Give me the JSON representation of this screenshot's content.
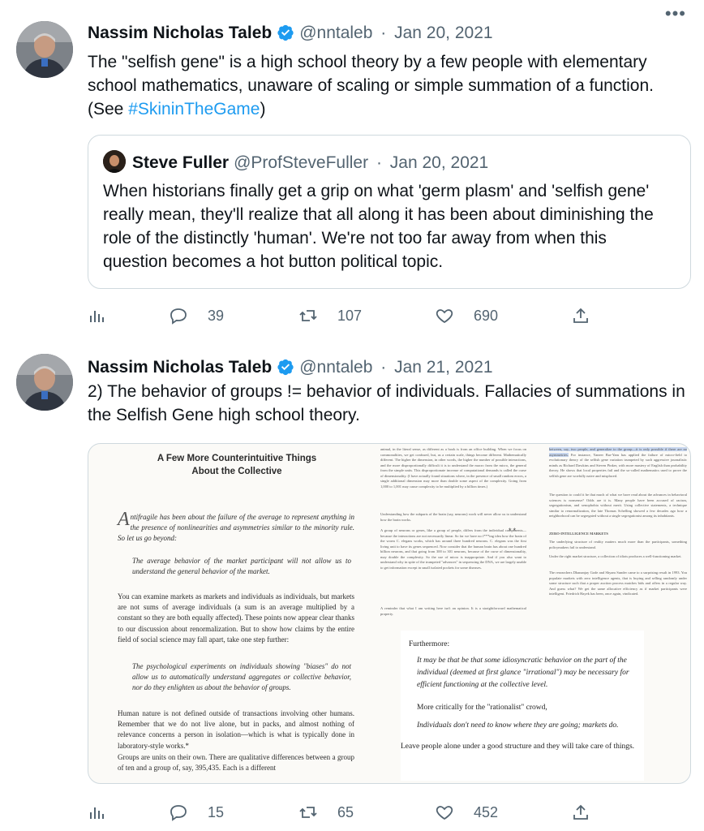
{
  "colors": {
    "link": "#1d9bf0",
    "secondary": "#536471",
    "verified": "#1d9bf0",
    "text": "#0f1419",
    "border": "#cfd9de"
  },
  "tweet1": {
    "author_name": "Nassim Nicholas Taleb",
    "handle": "@nntaleb",
    "separator": "·",
    "date": "Jan 20, 2021",
    "more": "•••",
    "text_main": "The \"selfish gene\" is a high school theory by a few people with elementary school mathematics, unaware of scaling or simple summation of a function. (See ",
    "hashtag": "#SkininTheGame",
    "text_end": ")",
    "quote": {
      "author_name": "Steve Fuller",
      "handle": "@ProfSteveFuller",
      "separator": "·",
      "date": "Jan 20, 2021",
      "text": "When historians finally get a grip on what 'germ plasm' and 'selfish gene' really mean, they'll realize that all along it has been about diminishing the role of the distinctly 'human'. We're not too far away from when this question becomes a hot button political topic."
    },
    "actions": {
      "replies": "39",
      "retweets": "107",
      "likes": "690"
    }
  },
  "tweet2": {
    "author_name": "Nassim Nicholas Taleb",
    "handle": "@nntaleb",
    "separator": "·",
    "date": "Jan 21, 2021",
    "more": "•••",
    "text": "2) The behavior of groups != behavior of individuals. Fallacies of summations in the Selfish Gene high school theory.",
    "media": {
      "book_title_line1": "A Few More Counterintuitive Things",
      "book_title_line2": "About the Collective",
      "p1_dropcap": "A",
      "p1": "ntifragile has been about the failure of the average to represent anything in the presence of nonlinearities and asymmetries similar to the minority rule. So let us go beyond:",
      "p2": "The average behavior of the market participant will not allow us to understand the general behavior of the market.",
      "p3": "You can examine markets as markets and individuals as individuals, but markets are not sums of average individuals (a sum is an average multiplied by a constant so they are both equally affected). These points now appear clear thanks to our discussion about renormalization. But to show how claims by the entire field of social science may fall apart, take one step further:",
      "p4": "The psychological experiments on individuals showing \"biases\" do not allow us to automatically understand aggregates or collective behavior, nor do they enlighten us about the behavior of groups.",
      "p5": "Human nature is not defined outside of transactions involving other humans. Remember that we do not live alone, but in packs, and almost nothing of relevance concerns a person in isolation—which is what is typically done in laboratory-style works.*",
      "p6": "Groups are units on their own. There are qualitative differences between a group of ten and a group of, say, 395,435. Each is a different",
      "dots": "**",
      "inset_furthermore": "Furthermore:",
      "inset_q1": "It may be that be that some idiosyncratic behavior on the part of the individual (deemed at first glance \"irrational\") may be necessary for efficient functioning at the collective level.",
      "inset_more": "More critically for the \"rationalist\" crowd,",
      "inset_q2": "Individuals don't need to know where they are going; markets do.",
      "inset_leave": "Leave people alone under a good structure and they will take care of things."
    },
    "actions": {
      "replies": "15",
      "retweets": "65",
      "likes": "452"
    }
  }
}
